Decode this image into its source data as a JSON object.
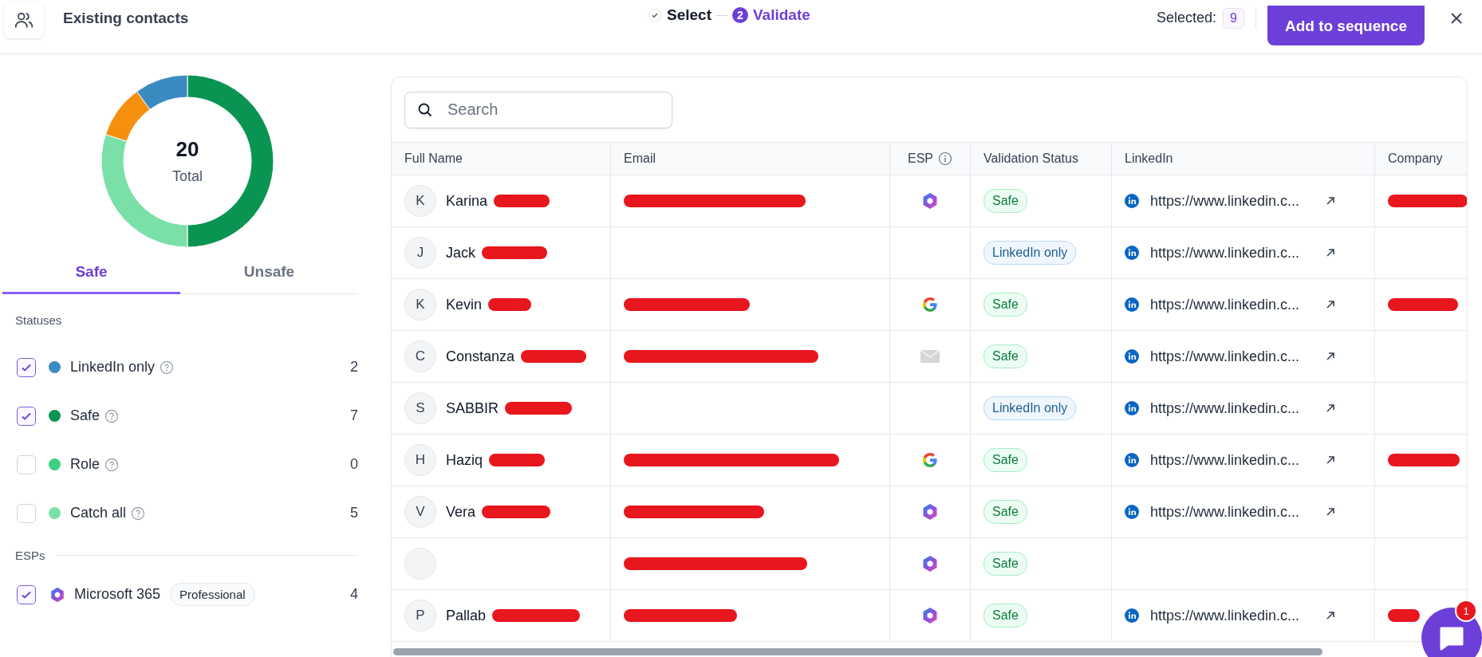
{
  "header": {
    "title": "Existing contacts",
    "selected_label": "Selected:",
    "selected_count": "9",
    "primary_button": "Add to sequence"
  },
  "steps": [
    {
      "label": "Select",
      "kind": "done",
      "selected": false
    },
    {
      "label": "Validate",
      "number": "2",
      "kind": "current",
      "selected": true
    }
  ],
  "donut": {
    "total": "20",
    "total_label": "Total"
  },
  "tabs": [
    {
      "label": "Safe",
      "selected": true
    },
    {
      "label": "Unsafe",
      "selected": false
    }
  ],
  "statuses_heading": "Statuses",
  "statuses": [
    {
      "label": "LinkedIn only",
      "color": "#3b8bc2",
      "count": "2",
      "checked": true
    },
    {
      "label": "Safe",
      "color": "#0a9452",
      "count": "7",
      "checked": true
    },
    {
      "label": "Role",
      "color": "#3ecf82",
      "count": "0",
      "checked": false
    },
    {
      "label": "Catch all",
      "color": "#7ae0a8",
      "count": "5",
      "checked": false
    }
  ],
  "esps_heading": "ESPs",
  "esps": [
    {
      "label": "Microsoft 365",
      "badge": "Professional",
      "count": "4",
      "checked": true
    }
  ],
  "search": {
    "placeholder": "Search"
  },
  "table": {
    "columns": [
      {
        "label": "Full Name",
        "info": false
      },
      {
        "label": "Email",
        "info": false
      },
      {
        "label": "ESP",
        "info": true
      },
      {
        "label": "Validation Status",
        "info": false
      },
      {
        "label": "LinkedIn",
        "info": false
      },
      {
        "label": "Company",
        "info": false
      }
    ],
    "rows": [
      {
        "initial": "K",
        "name": "Karina",
        "name_redacted": true,
        "email_redacted": true,
        "esp": {
          "kind": "microsoft"
        },
        "status": {
          "kind": "safe",
          "label": "Safe"
        },
        "linkedin": "https://www.linkedin.c...",
        "company_redacted": true
      },
      {
        "initial": "J",
        "name": "Jack",
        "name_redacted": true,
        "email_redacted": false,
        "status": {
          "kind": "linkedin",
          "label": "LinkedIn only"
        },
        "linkedin": "https://www.linkedin.c...",
        "company_redacted": false
      },
      {
        "initial": "K",
        "name": "Kevin",
        "name_redacted": true,
        "email_redacted": true,
        "esp": {
          "kind": "google"
        },
        "status": {
          "kind": "safe",
          "label": "Safe"
        },
        "linkedin": "https://www.linkedin.c...",
        "company_redacted": true
      },
      {
        "initial": "C",
        "name": "Constanza",
        "name_redacted": true,
        "email_redacted": true,
        "esp": {
          "kind": "mail"
        },
        "status": {
          "kind": "safe",
          "label": "Safe"
        },
        "linkedin": "https://www.linkedin.c...",
        "company_redacted": false
      },
      {
        "initial": "S",
        "name": "SABBIR",
        "name_redacted": true,
        "email_redacted": false,
        "status": {
          "kind": "linkedin",
          "label": "LinkedIn only"
        },
        "linkedin": "https://www.linkedin.c...",
        "company_redacted": false
      },
      {
        "initial": "H",
        "name": "Haziq",
        "name_redacted": true,
        "email_redacted": true,
        "esp": {
          "kind": "google"
        },
        "status": {
          "kind": "safe",
          "label": "Safe"
        },
        "linkedin": "https://www.linkedin.c...",
        "company_redacted": true
      },
      {
        "initial": "V",
        "name": "Vera",
        "name_redacted": true,
        "email_redacted": true,
        "esp": {
          "kind": "microsoft"
        },
        "status": {
          "kind": "safe",
          "label": "Safe"
        },
        "linkedin": "https://www.linkedin.c...",
        "company_redacted": false
      },
      {
        "name_redacted": false,
        "email_redacted": true,
        "esp": {
          "kind": "microsoft"
        },
        "status": {
          "kind": "safe",
          "label": "Safe"
        },
        "company_redacted": false
      },
      {
        "initial": "P",
        "name": "Pallab",
        "name_redacted": true,
        "email_redacted": true,
        "esp": {
          "kind": "microsoft"
        },
        "status": {
          "kind": "safe",
          "label": "Safe"
        },
        "linkedin": "https://www.linkedin.c...",
        "company_redacted": true
      }
    ]
  },
  "chat": {
    "badge": "1"
  }
}
